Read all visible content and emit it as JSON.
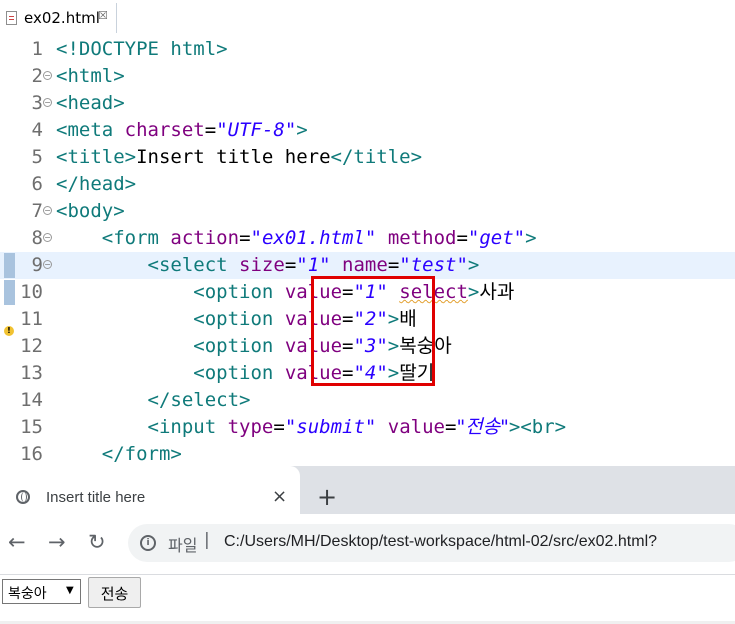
{
  "editor": {
    "tab_label": "ex02.html",
    "tab_close": "☒",
    "lines": [
      {
        "num": "1"
      },
      {
        "num": "2"
      },
      {
        "num": "3"
      },
      {
        "num": "4"
      },
      {
        "num": "5"
      },
      {
        "num": "6"
      },
      {
        "num": "7"
      },
      {
        "num": "8"
      },
      {
        "num": "9"
      },
      {
        "num": "10"
      },
      {
        "num": "11"
      },
      {
        "num": "12"
      },
      {
        "num": "13"
      },
      {
        "num": "14"
      },
      {
        "num": "15"
      },
      {
        "num": "16"
      }
    ],
    "code": {
      "doctype": "<!DOCTYPE html>",
      "html_open": "<html>",
      "head_open": "<head>",
      "meta_tag": "<meta",
      "charset_attr": "charset",
      "charset_val": "\"UTF-8\"",
      "title_open": "<title>",
      "title_text": "Insert title here",
      "title_close": "</title>",
      "head_close": "</head>",
      "body_open": "<body>",
      "form_tag": "<form",
      "action_attr": "action",
      "action_val": "\"ex01.html\"",
      "method_attr": "method",
      "method_val": "\"get\"",
      "select_tag": "<select",
      "size_attr": "size",
      "size_val": "\"1\"",
      "name_attr": "name",
      "name_val": "\"test\"",
      "option_tag": "<option",
      "value_attr": "value",
      "opt1_val": "\"1\"",
      "opt1_selected": "select",
      "opt1_text": "사과",
      "opt2_val": "\"2\"",
      "opt2_text": "배",
      "opt3_val": "\"3\"",
      "opt3_text": "복숭아",
      "opt4_val": "\"4\"",
      "opt4_text": "딸기",
      "select_close": "</select>",
      "input_tag": "<input",
      "type_attr": "type",
      "type_val": "\"submit\"",
      "input_value_val": "\"전송\"",
      "br_tag": "<br>",
      "form_close": "</form>"
    },
    "colors": {
      "tag": "#0f7a7a",
      "attribute": "#7f007f",
      "value": "#2a00ff",
      "highlight_box": "#e00000",
      "current_line": "#e8f2fe"
    }
  },
  "browser": {
    "tab_title": "Insert title here",
    "tab_close": "×",
    "new_tab": "+",
    "back": "←",
    "forward": "→",
    "reload": "↻",
    "omnibox_label": "파일",
    "omnibox_sep": "|",
    "url": "C:/Users/MH/Desktop/test-workspace/html-02/src/ex02.html?",
    "form": {
      "select_value": "복숭아",
      "submit_label": "전송"
    }
  }
}
